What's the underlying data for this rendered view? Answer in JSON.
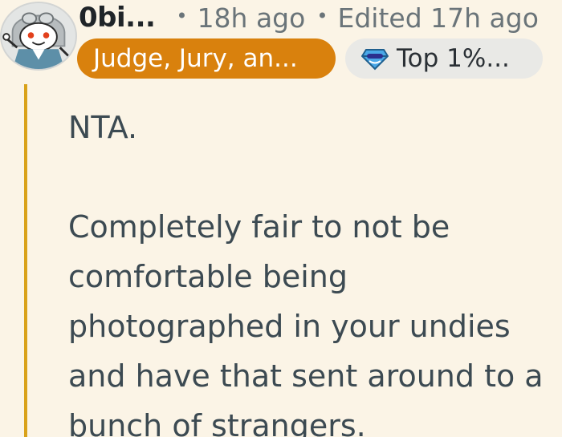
{
  "comment": {
    "author": "0bi...",
    "time": "18h ago",
    "edited": "Edited 17h ago",
    "separator": "•",
    "flairs": {
      "judge": "Judge, Jury, an...",
      "top": "Top 1%..."
    },
    "body": {
      "paragraph1": "NTA.",
      "paragraph2": "Completely fair to not be comfortable being photographed in your undies and have that sent around to a bunch of strangers."
    },
    "colors": {
      "background": "#fbf4e6",
      "judge_flair": "#d9810d",
      "thread_line": "#d9a21a"
    },
    "icons": {
      "avatar": "snoo-avatar",
      "top_flair": "gem-icon"
    }
  }
}
